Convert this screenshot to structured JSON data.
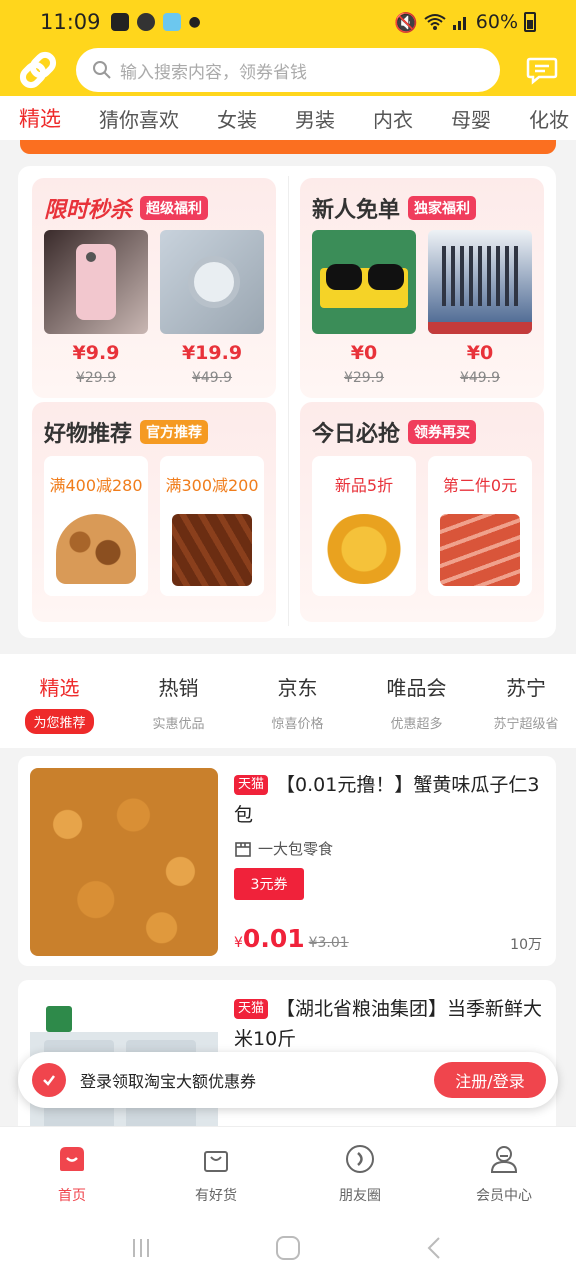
{
  "status_bar": {
    "time": "11:09",
    "battery": "60%"
  },
  "search": {
    "placeholder": "输入搜索内容，领券省钱"
  },
  "category_tabs": [
    "精选",
    "猜你喜欢",
    "女装",
    "男装",
    "内衣",
    "母婴",
    "化妆"
  ],
  "promo": {
    "flash": {
      "title": "限时秒杀",
      "tag": "超级福利",
      "items": [
        {
          "price": "¥9.9",
          "orig": "¥29.9"
        },
        {
          "price": "¥19.9",
          "orig": "¥49.9"
        }
      ]
    },
    "newuser": {
      "title": "新人免单",
      "tag": "独家福利",
      "items": [
        {
          "price": "¥0",
          "orig": "¥29.9"
        },
        {
          "price": "¥0",
          "orig": "¥49.9"
        }
      ]
    },
    "good": {
      "title": "好物推荐",
      "tag": "官方推荐",
      "subs": [
        "满400减280",
        "满300减200"
      ]
    },
    "today": {
      "title": "今日必抢",
      "tag": "领券再买",
      "subs": [
        "新品5折",
        "第二件0元"
      ]
    }
  },
  "source_tabs": [
    {
      "name": "精选",
      "sub": "为您推荐"
    },
    {
      "name": "热销",
      "sub": "实惠优品"
    },
    {
      "name": "京东",
      "sub": "惊喜价格"
    },
    {
      "name": "唯品会",
      "sub": "优惠超多"
    },
    {
      "name": "苏宁",
      "sub": "苏宁超级省"
    }
  ],
  "products": [
    {
      "platform": "天猫",
      "title": "【0.01元撸！】蟹黄味瓜子仁3包",
      "shop": "一大包零食",
      "coupon": "3元券",
      "price_symbol": "¥",
      "price": "0.01",
      "orig": "¥3.01",
      "sales": "10万"
    },
    {
      "platform": "天猫",
      "title": "【湖北省粮油集团】当季新鲜大米10斤"
    }
  ],
  "login_bar": {
    "text": "登录领取淘宝大额优惠券",
    "button": "注册/登录"
  },
  "bottom_nav": [
    "首页",
    "有好货",
    "朋友圈",
    "会员中心"
  ],
  "colors": {
    "brand_yellow": "#ffd61c",
    "accent_red": "#ee2a2a"
  }
}
